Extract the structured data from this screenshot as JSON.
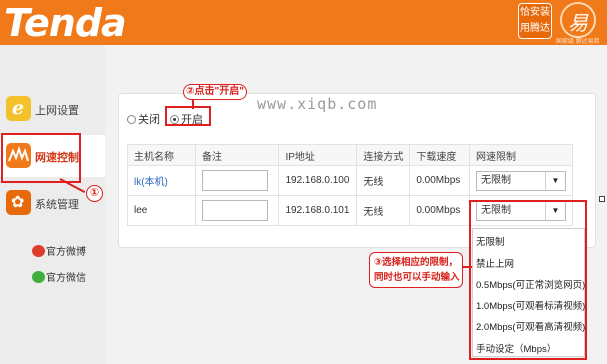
{
  "header": {
    "logo": "Tenda",
    "badge": [
      "恰安装",
      "用腾达"
    ],
    "brand_mark": "易",
    "brand_sub": "国家级 腾达易商"
  },
  "sidebar": {
    "items": [
      {
        "label": "上网设置",
        "icon": "ie-icon"
      },
      {
        "label": "网速控制",
        "icon": "speed-icon"
      },
      {
        "label": "系统管理",
        "icon": "gear-icon"
      }
    ],
    "links": [
      {
        "label": "官方微博",
        "icon": "weibo-icon"
      },
      {
        "label": "官方微信",
        "icon": "wechat-icon"
      }
    ]
  },
  "annotations": {
    "step1": "①",
    "step2": "②点击\"开启\"",
    "step3_line1": "③选择相应的限制，",
    "step3_line2": "同时也可以手动输入",
    "watermark": "www.xiqb.com"
  },
  "control": {
    "off_label": "关闭",
    "on_label": "开启",
    "selected": "开启"
  },
  "table": {
    "headers": [
      "主机名称",
      "备注",
      "IP地址",
      "连接方式",
      "下载速度",
      "网速限制"
    ],
    "rows": [
      {
        "host": "lk(本机)",
        "note": "",
        "ip": "192.168.0.100",
        "conn": "无线",
        "speed": "0.00Mbps",
        "limit": "无限制"
      },
      {
        "host": "lee",
        "note": "",
        "ip": "192.168.0.101",
        "conn": "无线",
        "speed": "0.00Mbps",
        "limit": "无限制"
      }
    ]
  },
  "dropdown_options": [
    "无限制",
    "禁止上网",
    "0.5Mbps(可正常浏览网页)",
    "1.0Mbps(可观看标清视频)",
    "2.0Mbps(可观看高清视频)",
    "手动设定（Mbps）"
  ],
  "colors": {
    "header": "#f07a1a",
    "annotation_red": "#e02020",
    "link_blue": "#2f67c2"
  }
}
